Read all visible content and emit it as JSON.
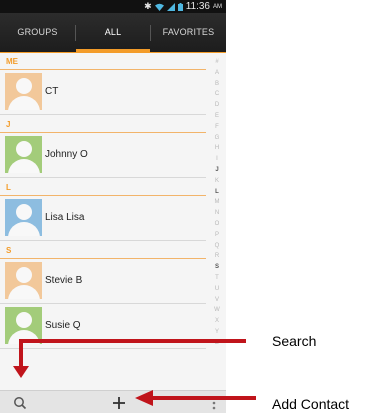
{
  "status_bar": {
    "time": "11:36",
    "ampm": "AM"
  },
  "tabs": [
    {
      "label": "GROUPS",
      "active": false
    },
    {
      "label": "ALL",
      "active": true
    },
    {
      "label": "FAVORITES",
      "active": false
    }
  ],
  "sections": [
    {
      "letter": "ME",
      "contacts": [
        {
          "name": "CT",
          "avatar_color": "#f2c89a"
        }
      ]
    },
    {
      "letter": "J",
      "contacts": [
        {
          "name": "Johnny O",
          "avatar_color": "#a3cc7a"
        }
      ]
    },
    {
      "letter": "L",
      "contacts": [
        {
          "name": "Lisa Lisa",
          "avatar_color": "#8dbde0"
        }
      ]
    },
    {
      "letter": "S",
      "contacts": [
        {
          "name": "Stevie B",
          "avatar_color": "#f2c89a"
        },
        {
          "name": "Susie Q",
          "avatar_color": "#a3cc7a"
        }
      ]
    }
  ],
  "index_letters": [
    "#",
    "A",
    "B",
    "C",
    "D",
    "E",
    "F",
    "G",
    "H",
    "I",
    "J",
    "K",
    "L",
    "M",
    "N",
    "O",
    "P",
    "Q",
    "R",
    "S",
    "T",
    "U",
    "V",
    "W",
    "X",
    "Y",
    "Z"
  ],
  "index_highlighted": [
    "J",
    "L",
    "S"
  ],
  "bottom_bar": [
    {
      "icon": "search-icon"
    },
    {
      "icon": "add-icon"
    },
    {
      "icon": "overflow-menu-icon"
    }
  ],
  "annotations": {
    "search_label": "Search",
    "add_contact_label": "Add Contact"
  },
  "colors": {
    "accent": "#f39c2a",
    "arrow": "#c0141b",
    "status_signal": "#4fb7e0"
  }
}
